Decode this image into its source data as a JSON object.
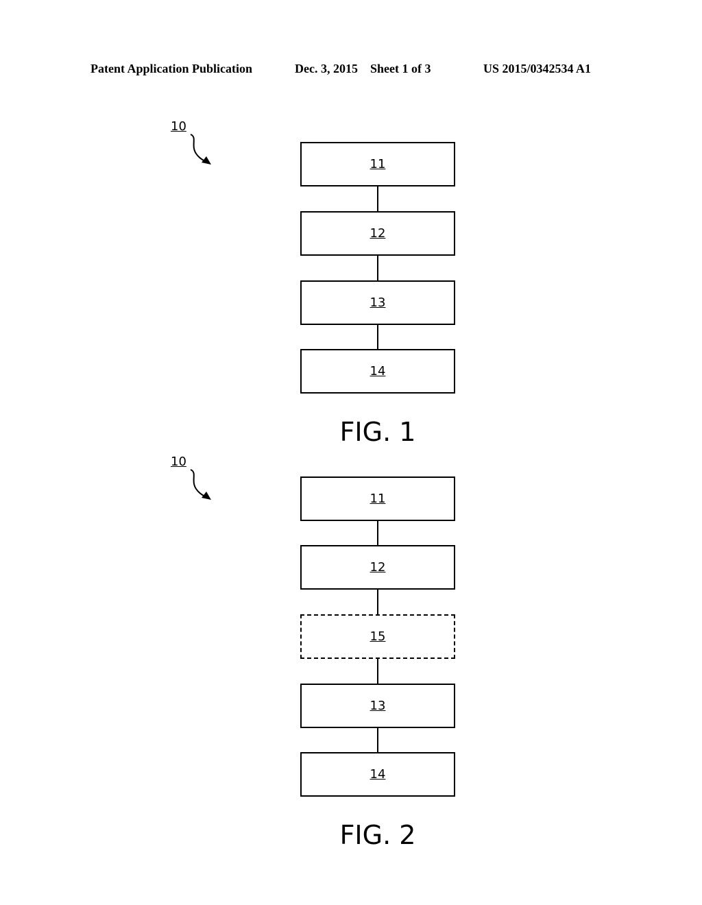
{
  "header": {
    "publication": "Patent Application Publication",
    "date_sheet": "Dec. 3, 2015    Sheet 1 of 3",
    "number": "US 2015/0342534 A1"
  },
  "figures": [
    {
      "label": "FIG. 1",
      "reference": "10",
      "boxes": [
        {
          "label": "11",
          "style": "solid"
        },
        {
          "label": "12",
          "style": "solid"
        },
        {
          "label": "13",
          "style": "solid"
        },
        {
          "label": "14",
          "style": "solid"
        }
      ]
    },
    {
      "label": "FIG. 2",
      "reference": "10",
      "boxes": [
        {
          "label": "11",
          "style": "solid"
        },
        {
          "label": "12",
          "style": "solid"
        },
        {
          "label": "15",
          "style": "dashed"
        },
        {
          "label": "13",
          "style": "solid"
        },
        {
          "label": "14",
          "style": "solid"
        }
      ]
    }
  ]
}
